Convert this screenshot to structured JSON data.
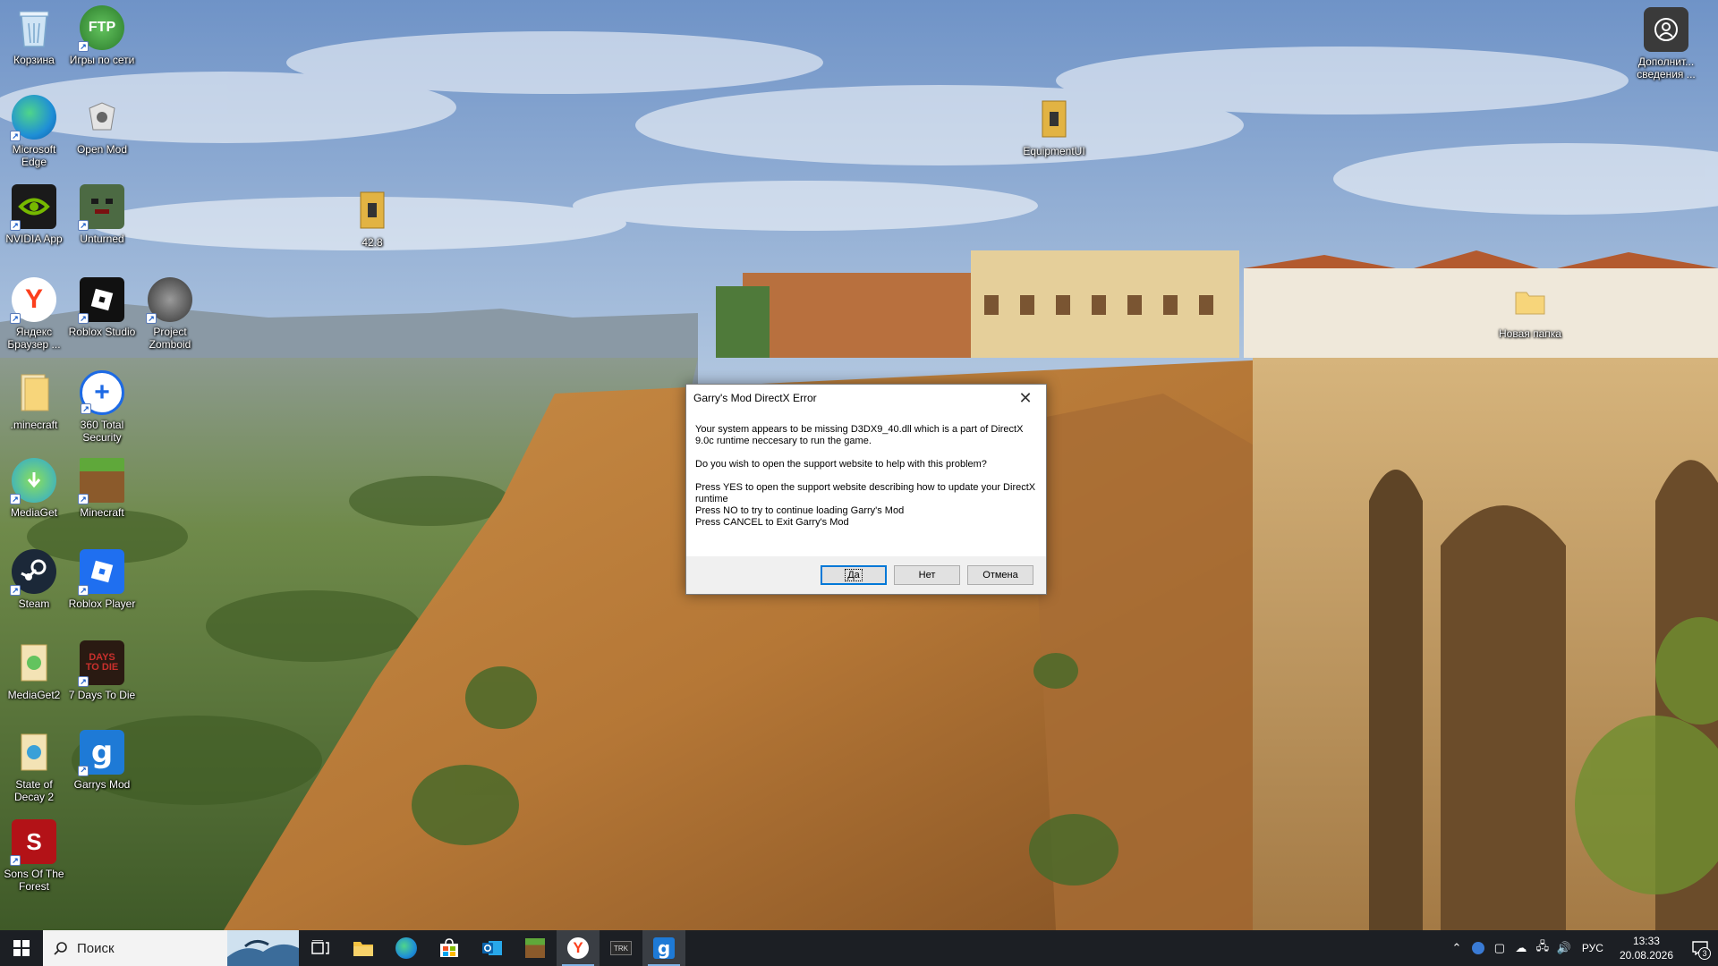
{
  "desktop": {
    "icons": [
      {
        "label": "Корзина",
        "icon": "recycle-bin-icon",
        "color": "#9cc7e8"
      },
      {
        "label": "Игры по сети",
        "icon": "ftp-icon",
        "color": "#3f9a3a"
      },
      {
        "label": "Microsoft Edge",
        "icon": "edge-icon",
        "color": "#1f8fd6"
      },
      {
        "label": "Open Mod",
        "icon": "openmod-icon",
        "color": "#d7d7d7"
      },
      {
        "label": "NVIDIA App",
        "icon": "nvidia-icon",
        "color": "#76b900"
      },
      {
        "label": "Unturned",
        "icon": "unturned-icon",
        "color": "#4c6a43"
      },
      {
        "label": "42.8",
        "icon": "archive-icon",
        "color": "#e2b343"
      },
      {
        "label": "Яндекс Браузер ...",
        "icon": "yandex-browser-icon",
        "color": "#ffffff"
      },
      {
        "label": "Roblox Studio",
        "icon": "roblox-studio-icon",
        "color": "#111111"
      },
      {
        "label": "Project Zomboid",
        "icon": "zomboid-icon",
        "color": "#5a5a5a"
      },
      {
        "label": ".minecraft",
        "icon": "folder-icon",
        "color": "#f3d684"
      },
      {
        "label": "360 Total Security",
        "icon": "360-security-icon",
        "color": "#1d6ae5"
      },
      {
        "label": "MediaGet",
        "icon": "mediaget-icon",
        "color": "#2aa6d9"
      },
      {
        "label": "Minecraft",
        "icon": "minecraft-icon",
        "color": "#6b8f3a"
      },
      {
        "label": "Steam",
        "icon": "steam-icon",
        "color": "#1b2838"
      },
      {
        "label": "Roblox Player",
        "icon": "roblox-player-icon",
        "color": "#1f6ff0"
      },
      {
        "label": "MediaGet2",
        "icon": "archive-icon",
        "color": "#f3d684"
      },
      {
        "label": "7 Days To Die",
        "icon": "7dtd-icon",
        "color": "#2a1a12"
      },
      {
        "label": "State of Decay 2",
        "icon": "archive-icon",
        "color": "#f3d684"
      },
      {
        "label": "Garrys Mod",
        "icon": "gmod-icon",
        "color": "#1e7ad6"
      },
      {
        "label": "Sons Of The Forest",
        "icon": "sotf-icon",
        "color": "#b31217"
      },
      {
        "label": "EquipmentUI",
        "icon": "archive-icon",
        "color": "#e2b343"
      },
      {
        "label": "Новая папка",
        "icon": "folder-icon",
        "color": "#f3d684"
      },
      {
        "label": "Дополнит... сведения ...",
        "icon": "user-info-icon",
        "color": "#333333"
      }
    ]
  },
  "dialog": {
    "title": "Garry's Mod DirectX Error",
    "line1": "Your system appears to be missing D3DX9_40.dll which is a part of DirectX 9.0c runtime neccesary to run the game.",
    "line2": "Do you wish to open the support website to help with this problem?",
    "line3": "Press YES to open the support website describing how to update your DirectX runtime",
    "line4": "Press NO to try to continue loading Garry's Mod",
    "line5": "Press CANCEL to Exit Garry's Mod",
    "yes_label": "Да",
    "no_label": "Нет",
    "cancel_label": "Отмена"
  },
  "taskbar": {
    "search_placeholder": "Поиск",
    "apps": [
      "task-view-icon",
      "file-explorer-icon",
      "edge-icon",
      "store-icon",
      "outlook-icon",
      "minecraft-icon",
      "yandex-browser-icon",
      "app-icon",
      "gmod-icon"
    ],
    "language": "РУС",
    "time": "13:33",
    "date": "20.08.2026",
    "notification_count": "3"
  }
}
